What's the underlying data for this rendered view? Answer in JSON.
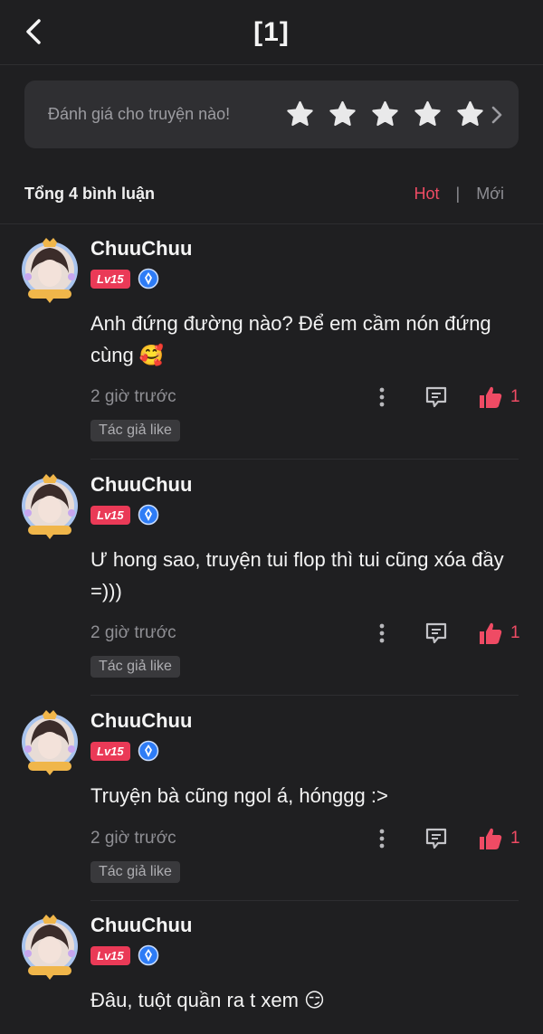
{
  "header": {
    "title": "[1]",
    "back_icon": "chevron-left-icon"
  },
  "rating": {
    "prompt": "Đánh giá cho truyện nào!",
    "stars": 5
  },
  "summary": {
    "total": "Tổng 4 bình luận",
    "sort_hot": "Hot",
    "sort_separator": "|",
    "sort_new": "Mới"
  },
  "colors": {
    "accent": "#ef4b64",
    "background": "#1f1f21",
    "card": "#2f2f32",
    "level_badge": "#ea3a57",
    "vip_badge": "#2e7cf6"
  },
  "comments": [
    {
      "user": "ChuuChuu",
      "level": "Lv15",
      "text": "Anh đứng đường nào? Để em cầm nón đứng cùng 🥰",
      "time": "2 giờ trước",
      "likes": "1",
      "tag": "Tác giả like"
    },
    {
      "user": "ChuuChuu",
      "level": "Lv15",
      "text": "Ư hong sao, truyện tui flop thì tui cũng xóa đầy =)))",
      "time": "2 giờ trước",
      "likes": "1",
      "tag": "Tác giả like"
    },
    {
      "user": "ChuuChuu",
      "level": "Lv15",
      "text": "Truyện bà cũng ngol á, hónggg :>",
      "time": "2 giờ trước",
      "likes": "1",
      "tag": "Tác giả like"
    },
    {
      "user": "ChuuChuu",
      "level": "Lv15",
      "text": "Đâu, tuột quần ra t xem 😏"
    }
  ]
}
